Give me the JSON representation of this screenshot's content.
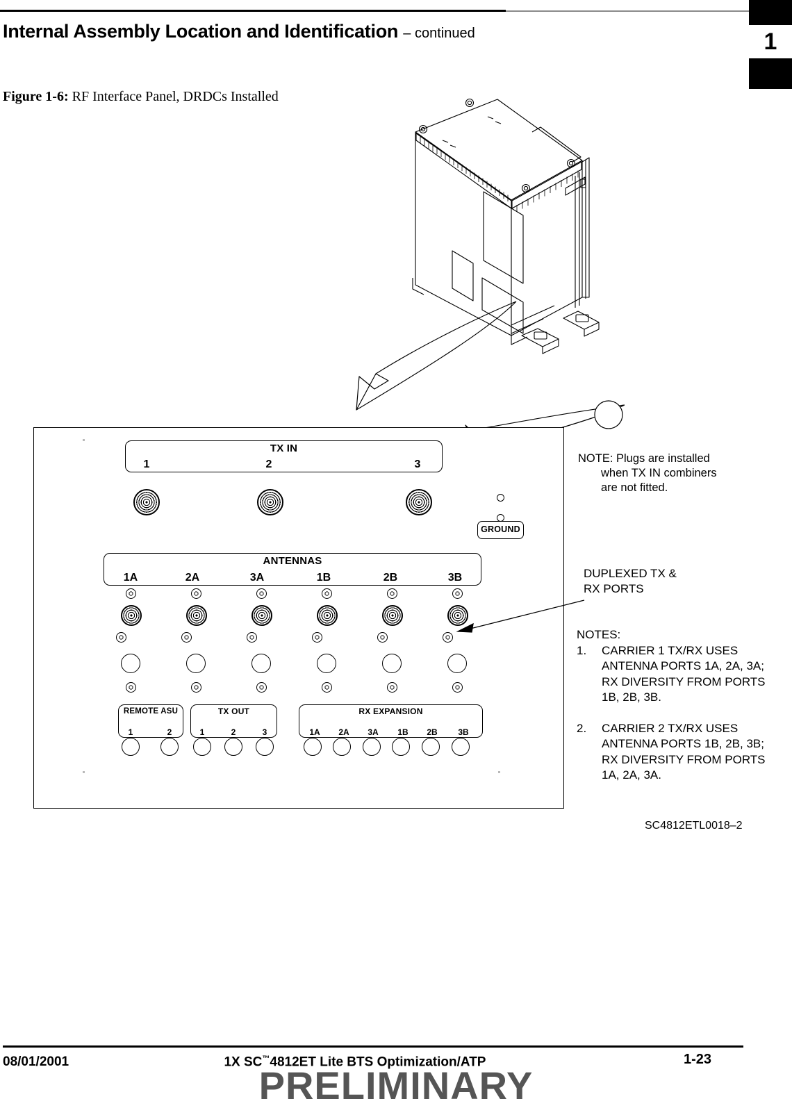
{
  "header": {
    "title_main": "Internal Assembly Location and Identification",
    "title_suffix": "– continued",
    "chapter_tab": "1"
  },
  "figure": {
    "label": "Figure 1-6:",
    "caption": "RF Interface Panel, DRDCs Installed",
    "drawing_number": "SC4812ETL0018–2"
  },
  "panel": {
    "tx_in": {
      "title": "TX IN",
      "ports": [
        "1",
        "2",
        "3"
      ]
    },
    "ground": {
      "label": "GROUND"
    },
    "antennas": {
      "title": "ANTENNAS",
      "ports": [
        "1A",
        "2A",
        "3A",
        "1B",
        "2B",
        "3B"
      ]
    },
    "remote_asu": {
      "title": "REMOTE  ASU",
      "ports": [
        "1",
        "2"
      ]
    },
    "tx_out": {
      "title": "TX OUT",
      "ports": [
        "1",
        "2",
        "3"
      ]
    },
    "rx_expansion": {
      "title": "RX  EXPANSION",
      "ports": [
        "1A",
        "2A",
        "3A",
        "1B",
        "2B",
        "3B"
      ]
    }
  },
  "annotations": {
    "note_plugs_line1": "NOTE: Plugs are installed",
    "note_plugs_line2": "when TX IN combiners",
    "note_plugs_line3": "are not fitted.",
    "duplexed_line1": "DUPLEXED TX &",
    "duplexed_line2": "RX PORTS",
    "notes_heading": "NOTES:",
    "notes": [
      {
        "number": "1.",
        "text": "CARRIER 1 TX/RX USES ANTENNA PORTS 1A, 2A, 3A; RX DIVERSITY FROM PORTS 1B, 2B, 3B."
      },
      {
        "number": "2.",
        "text": "CARRIER 2 TX/RX USES ANTENNA PORTS 1B, 2B, 3B; RX DIVERSITY FROM PORTS 1A, 2A, 3A."
      }
    ]
  },
  "footer": {
    "date": "08/01/2001",
    "doc_title_pre": "1X SC",
    "doc_title_tm": "™",
    "doc_title_post": "4812ET Lite BTS Optimization/ATP",
    "page": "1-23",
    "watermark": "PRELIMINARY"
  }
}
